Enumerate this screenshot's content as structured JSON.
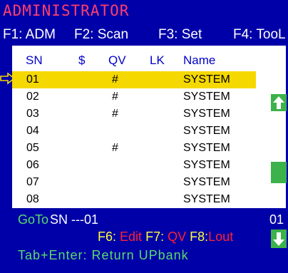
{
  "header": {
    "title": "ADMINISTRATOR"
  },
  "fkeys": [
    {
      "label": "F1: ADM"
    },
    {
      "label": "F2: Scan"
    },
    {
      "label": "F3: Set"
    },
    {
      "label": "F4: TooL"
    }
  ],
  "table": {
    "columns": [
      "SN",
      "$",
      "QV",
      "LK",
      "Name"
    ],
    "rows": [
      {
        "sn": "01",
        "dollar": "",
        "qv": "#",
        "lk": "",
        "name": "SYSTEM"
      },
      {
        "sn": "02",
        "dollar": "",
        "qv": "#",
        "lk": "",
        "name": "SYSTEM"
      },
      {
        "sn": "03",
        "dollar": "",
        "qv": "#",
        "lk": "",
        "name": "SYSTEM"
      },
      {
        "sn": "04",
        "dollar": "",
        "qv": "",
        "lk": "",
        "name": "SYSTEM"
      },
      {
        "sn": "05",
        "dollar": "",
        "qv": "#",
        "lk": "",
        "name": "SYSTEM"
      },
      {
        "sn": "06",
        "dollar": "",
        "qv": "",
        "lk": "",
        "name": "SYSTEM"
      },
      {
        "sn": "07",
        "dollar": "",
        "qv": "",
        "lk": "",
        "name": "SYSTEM"
      },
      {
        "sn": "08",
        "dollar": "",
        "qv": "",
        "lk": "",
        "name": "SYSTEM"
      }
    ],
    "selected_index": 0
  },
  "goto": {
    "label": "GoTo",
    "sn_text": "SN ---01",
    "page": "01"
  },
  "shortcuts": {
    "f6_key": "F6:",
    "f6_label": "Edit",
    "f7_key": "F7:",
    "f7_label": "QV",
    "f8_key": "F8:",
    "f8_label": "Lout"
  },
  "hint": {
    "text": "Tab+Enter: Return UPbank"
  },
  "colors": {
    "background": "#0000a8",
    "title": "#ff3f6c",
    "header_text": "#0000c8",
    "selected_row": "#f5d800",
    "green": "#3cb24a",
    "red_label": "#ff2030",
    "yellow_key": "#ffff3c"
  }
}
